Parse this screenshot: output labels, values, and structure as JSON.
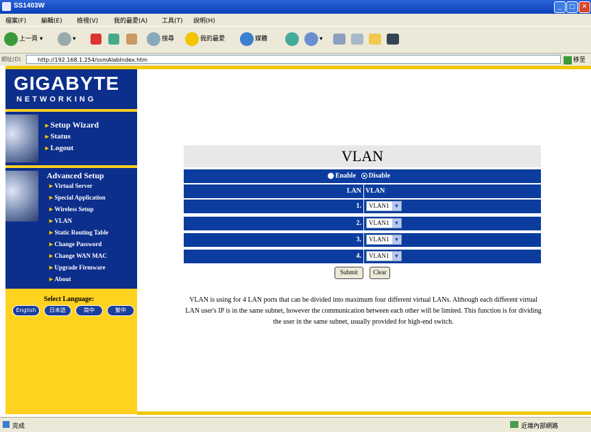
{
  "window": {
    "title": "SS1403W"
  },
  "menu": [
    "檔案(F)",
    "編輯(E)",
    "檢視(V)",
    "我的最愛(A)",
    "工具(T)",
    "說明(H)"
  ],
  "toolbar": {
    "back": "上一頁",
    "search": "搜尋",
    "favorites": "我的最愛",
    "media": "媒體"
  },
  "address": {
    "label": "網址(D)",
    "url": "http://192.168.1.254/ssmAlabIndex.htm",
    "go": "移至"
  },
  "logo": {
    "brand": "GIGABYTE",
    "sub": "NETWORKING"
  },
  "nav": {
    "main": [
      "Setup Wizard",
      "Status",
      "Logout"
    ],
    "advanced_title": "Advanced Setup",
    "advanced": [
      "Virtual Server",
      "Special Application",
      "Wireless Setup",
      "VLAN",
      "Static Routing Table",
      "Change Password",
      "Change WAN MAC",
      "Upgrade Firmware",
      "About"
    ]
  },
  "language": {
    "label": "Select Language:",
    "options": [
      "English",
      "日本語",
      "简中",
      "繁中"
    ]
  },
  "vlan": {
    "title": "VLAN",
    "enable": "Enable",
    "disable": "Disable",
    "selected_mode": "Disable",
    "header": {
      "lan": "LAN",
      "vlan": "VLAN"
    },
    "rows": [
      {
        "lan": "1.",
        "vlan": "VLAN1"
      },
      {
        "lan": "2.",
        "vlan": "VLAN1"
      },
      {
        "lan": "3.",
        "vlan": "VLAN1"
      },
      {
        "lan": "4.",
        "vlan": "VLAN1"
      }
    ],
    "submit": "Submit",
    "clear": "Clear",
    "description": "VLAN is using for 4 LAN ports that can be divided into maximum four different virtual LANs. Although each different virtual LAN user's IP is in the same subnet, however the communication between each other will be limited. This function is for dividing the user in the same subnet, usually provided for high-end switch."
  },
  "status": {
    "left": "完成",
    "right": "近端內部網路"
  }
}
